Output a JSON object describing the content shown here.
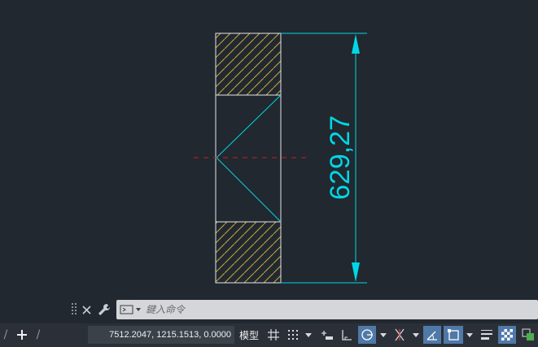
{
  "drawing": {
    "dimension_text": "629,27",
    "colors": {
      "background": "#212830",
      "outline": "#e6e6e6",
      "hatch": "#c8aa3c",
      "cyan": "#00d7e6",
      "centerline": "#c81e1e"
    }
  },
  "command_line": {
    "placeholder": "鍵入命令",
    "close_icon": "close-icon",
    "customize_icon": "wrench-icon",
    "command_icon": "command-prompt-icon"
  },
  "status_bar": {
    "coordinates": "7512.2047, 1215.1513, 0.0000",
    "model_label": "模型",
    "icons": [
      "grid-icon",
      "snap-icon",
      "infer-constraints-icon",
      "ortho-icon",
      "polar-tracking-icon",
      "isodraft-icon",
      "dynamic-ucs-icon",
      "object-snap-icon",
      "lineweight-icon",
      "transparency-icon",
      "selection-cycling-icon"
    ],
    "active_colors": {
      "toggle_on": "#4f79a8"
    }
  }
}
